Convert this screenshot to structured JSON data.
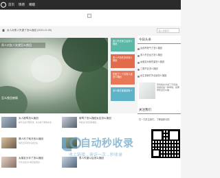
{
  "nav": {
    "items": [
      "首页",
      "情感",
      "婚姻"
    ]
  },
  "breadcrumb": {
    "text": "女人对男人失望了怎么挽回 (2023-12-09)"
  },
  "search": {
    "placeholder": "输入关键词..."
  },
  "hero": {
    "title": "男人对女人失望怎么挽回",
    "caption": "怎么挽回感情",
    "tiles": [
      {
        "text": "男人失去你之后怎么挽回",
        "color": "#5bb8a7"
      },
      {
        "text": "男人不怕失去你怎么挽回",
        "color": "#e36b4c"
      },
      {
        "text": "失败了一个月男人还怎么挽回",
        "color": "#e87858"
      },
      {
        "text": "怎么做才能挽回男人",
        "color": "#5fb3c8"
      }
    ]
  },
  "sidebar": {
    "title": "今日头条",
    "items": [
      "女孩吊丧气了怎么挽回",
      "男人失去女方怎么挽回",
      "女朋友对我失望怎么挽回",
      "三观不合怎么挽回",
      "女生说我们不合适怎么挽回"
    ],
    "excerpt": "有时候女方说了不合适，但其实是一种考验，如果你知道怎么做...",
    "follow_title": "关注我们",
    "follow_note": "扫一扫关注我们，了解最新动态"
  },
  "posts": [
    {
      "title": "女人被骂怎么挽回",
      "sub": "被骂之后不要慌张，先冷静下来想办法..."
    },
    {
      "title": "被骂了怎么挽回女友怎么挽回",
      "sub": "学会这几招就能挽回..."
    },
    {
      "title": "情人吵了就冷怎么挽回",
      "sub": "情侣之间吵架冷战之后..."
    },
    {
      "title": "女朋友分手了怎么挽回",
      "sub": "分手之后怎么挽回女朋友..."
    },
    {
      "title": "男人失望以后怎么挽回",
      "sub": "失望攒够了就离开..."
    },
    {
      "title": "女人吵架以后怎么挽回",
      "sub": "吵架之后冷静下来..."
    }
  ],
  "watermark": {
    "text": "自动秒收录",
    "sub": "收上链接→来访一次→秒收录"
  }
}
